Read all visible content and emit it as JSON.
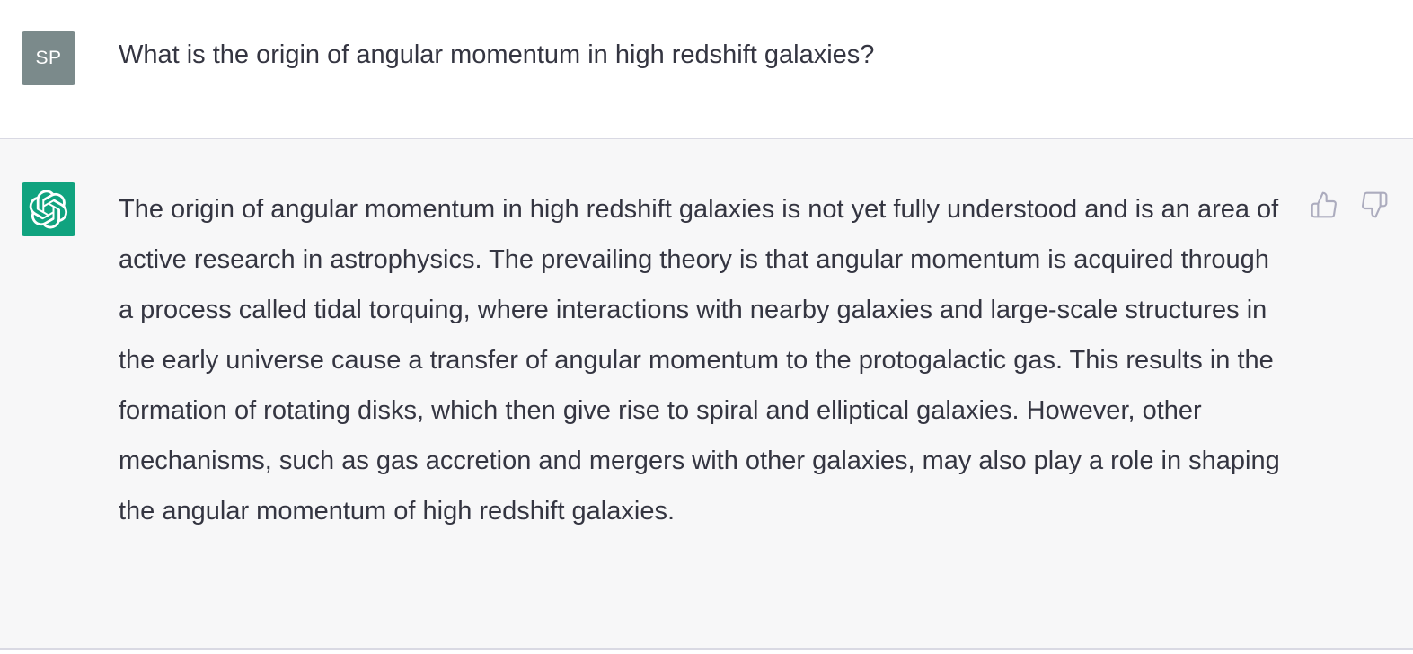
{
  "user_message": {
    "avatar_initials": "SP",
    "text": "What is the origin of angular momentum in high redshift galaxies?"
  },
  "assistant_message": {
    "avatar_icon": "openai-logo-icon",
    "text": "The origin of angular momentum in high redshift galaxies is not yet fully understood and is an area of active research in astrophysics. The prevailing theory is that angular momentum is acquired through a process called tidal torquing, where interactions with nearby galaxies and large-scale structures in the early universe cause a transfer of angular momentum to the protogalactic gas. This results in the formation of rotating disks, which then give rise to spiral and elliptical galaxies. However, other mechanisms, such as gas accretion and mergers with other galaxies, may also play a role in shaping the angular momentum of high redshift galaxies.",
    "feedback_icons": [
      "thumbs-up-icon",
      "thumbs-down-icon"
    ]
  },
  "colors": {
    "user_avatar_bg": "#7b8a8b",
    "assistant_avatar_bg": "#10a37f",
    "assistant_bg": "#f7f7f8",
    "text": "#343541",
    "icon": "#acacbe"
  }
}
